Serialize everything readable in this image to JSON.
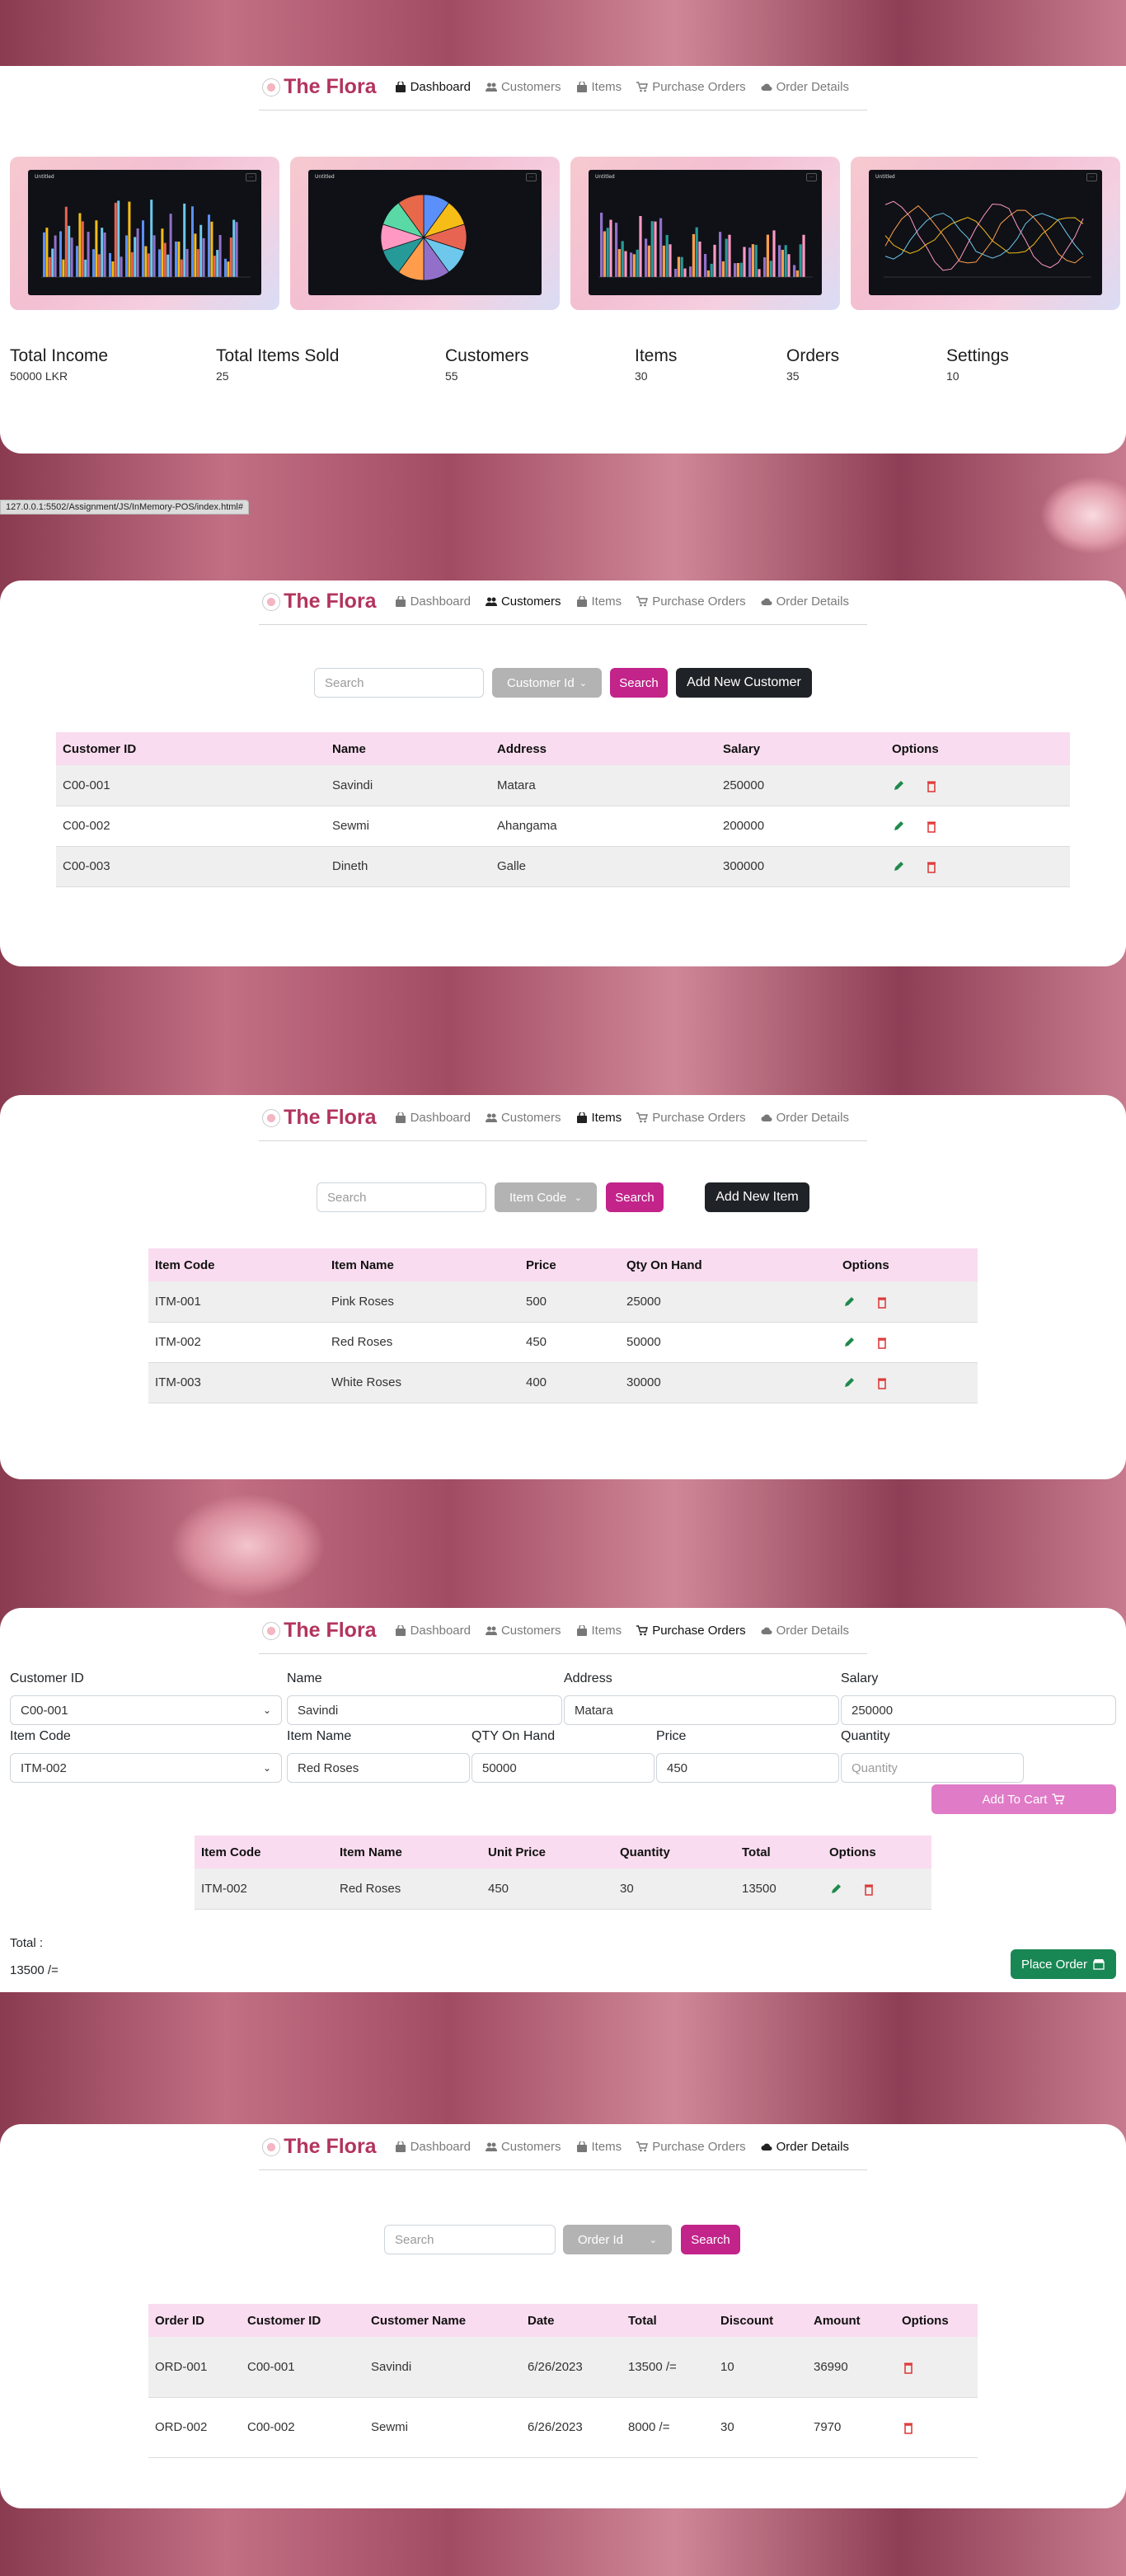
{
  "brand": {
    "name": "The Flora"
  },
  "nav": {
    "dashboard": "Dashboard",
    "customers": "Customers",
    "items": "Items",
    "purchase_orders": "Purchase Orders",
    "order_details": "Order Details"
  },
  "dashboard": {
    "stats": [
      {
        "label": "Total Income",
        "value": "50000 LKR"
      },
      {
        "label": "Total Items Sold",
        "value": "25"
      },
      {
        "label": "Customers",
        "value": "55"
      },
      {
        "label": "Items",
        "value": "30"
      },
      {
        "label": "Orders",
        "value": "35"
      },
      {
        "label": "Settings",
        "value": "10"
      }
    ],
    "chart_titles": [
      "Untitled",
      "Untitled",
      "Untitled",
      "Untitled"
    ]
  },
  "status_bar": {
    "url": "127.0.0.1:5502/Assignment/JS/InMemory-POS/index.html#"
  },
  "customers": {
    "search_placeholder": "Search",
    "filter_selected": "Customer Id",
    "search_button": "Search",
    "add_button": "Add New Customer",
    "columns": [
      "Customer ID",
      "Name",
      "Address",
      "Salary",
      "Options"
    ],
    "rows": [
      [
        "C00-001",
        "Savindi",
        "Matara",
        "250000"
      ],
      [
        "C00-002",
        "Sewmi",
        "Ahangama",
        "200000"
      ],
      [
        "C00-003",
        "Dineth",
        "Galle",
        "300000"
      ]
    ]
  },
  "items": {
    "search_placeholder": "Search",
    "filter_selected": "Item Code",
    "search_button": "Search",
    "add_button": "Add New Item",
    "columns": [
      "Item Code",
      "Item Name",
      "Price",
      "Qty On Hand",
      "Options"
    ],
    "rows": [
      [
        "ITM-001",
        "Pink Roses",
        "500",
        "25000"
      ],
      [
        "ITM-002",
        "Red Roses",
        "450",
        "50000"
      ],
      [
        "ITM-003",
        "White Roses",
        "400",
        "30000"
      ]
    ]
  },
  "purchase": {
    "labels": {
      "customer_id": "Customer ID",
      "name": "Name",
      "address": "Address",
      "salary": "Salary",
      "item_code": "Item Code",
      "item_name": "Item Name",
      "qty_on_hand": "QTY On Hand",
      "price": "Price",
      "quantity": "Quantity"
    },
    "values": {
      "customer_id": "C00-001",
      "name": "Savindi",
      "address": "Matara",
      "salary": "250000",
      "item_code": "ITM-002",
      "item_name": "Red Roses",
      "qty_on_hand": "50000",
      "price": "450"
    },
    "quantity_placeholder": "Quantity",
    "add_to_cart": "Add To Cart",
    "columns": [
      "Item Code",
      "Item Name",
      "Unit Price",
      "Quantity",
      "Total",
      "Options"
    ],
    "rows": [
      [
        "ITM-002",
        "Red Roses",
        "450",
        "30",
        "13500"
      ]
    ],
    "total_label": "Total :",
    "total_value": "13500 /=",
    "place_order": "Place Order"
  },
  "orders": {
    "search_placeholder": "Search",
    "filter_selected": "Order Id",
    "search_button": "Search",
    "columns": [
      "Order ID",
      "Customer ID",
      "Customer Name",
      "Date",
      "Total",
      "Discount",
      "Amount",
      "Options"
    ],
    "rows": [
      [
        "ORD-001",
        "C00-001",
        "Savindi",
        "6/26/2023",
        "13500 /=",
        "10",
        "36990"
      ],
      [
        "ORD-002",
        "C00-002",
        "Sewmi",
        "6/26/2023",
        "8000 /=",
        "30",
        "7970"
      ]
    ]
  },
  "colors": {
    "brand": "#b2345d",
    "pink_button": "#c2248a",
    "header_row": "#f9dcef",
    "place_order": "#198754"
  }
}
